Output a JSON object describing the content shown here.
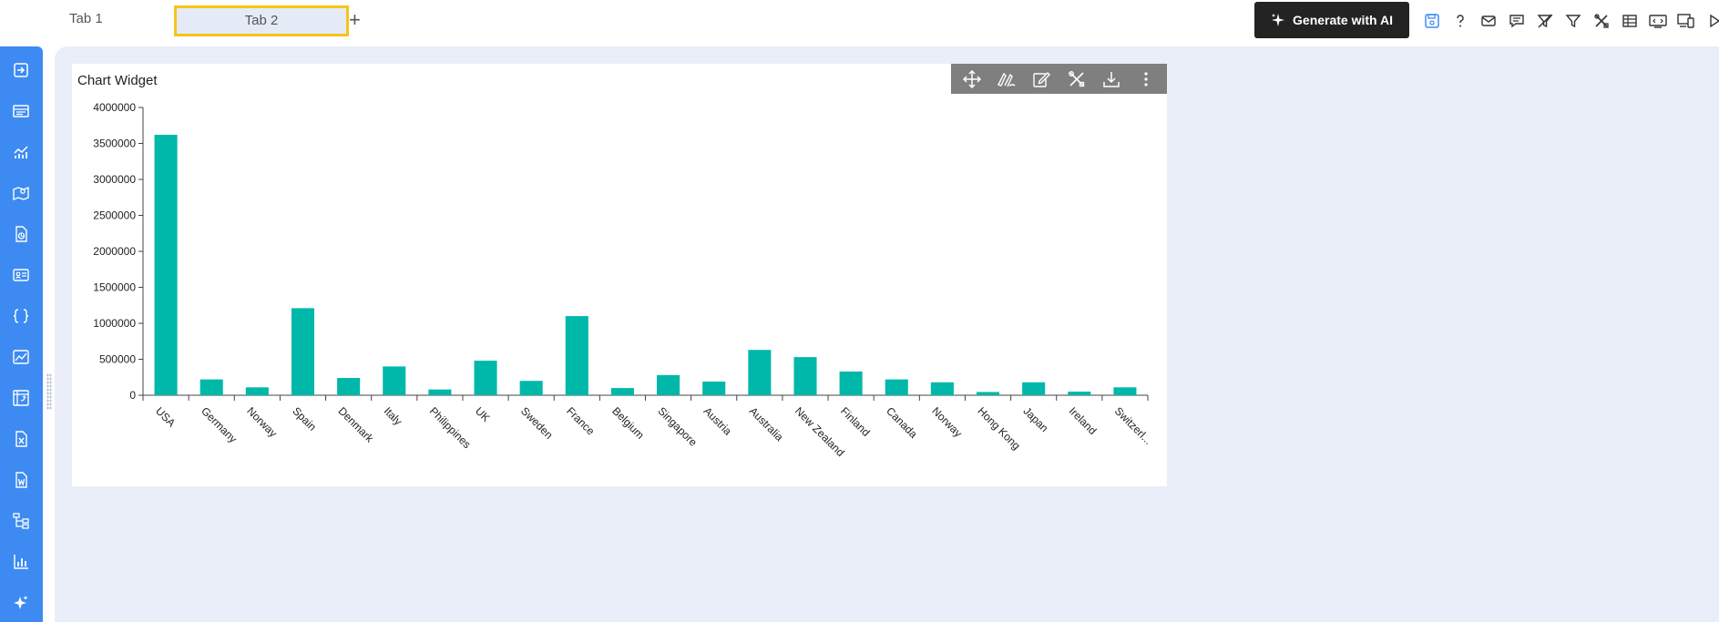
{
  "tabs": [
    {
      "label": "Tab 1"
    },
    {
      "label": "Tab 2"
    }
  ],
  "add_tab_label": "+",
  "generate_button": {
    "label": "Generate with AI"
  },
  "toolbar_icons": [
    "save-icon",
    "help-icon",
    "mail-icon",
    "comment-icon",
    "clear-filter-icon",
    "filter-icon",
    "tools-icon",
    "table-icon",
    "embed-icon",
    "devices-icon",
    "play-icon"
  ],
  "sidebar_icons": [
    "import-icon",
    "list-icon",
    "chart-icon",
    "map-icon",
    "report-icon",
    "id-card-icon",
    "code-braces-icon",
    "image-chart-icon",
    "pivot-icon",
    "excel-icon",
    "word-icon",
    "tree-icon",
    "bar-chart-icon",
    "sparkle-icon"
  ],
  "widget": {
    "title": "Chart Widget",
    "toolbar": [
      "move-icon",
      "draw-icon",
      "edit-icon",
      "settings-icon",
      "download-icon",
      "more-icon"
    ]
  },
  "colors": {
    "accent": "#3d8bf2",
    "bar": "#00b8a9",
    "highlight": "#f5c518"
  },
  "chart_data": {
    "type": "bar",
    "title": "",
    "xlabel": "",
    "ylabel": "",
    "categories": [
      "USA",
      "Germany",
      "Norway",
      "Spain",
      "Denmark",
      "Italy",
      "Philippines",
      "UK",
      "Sweden",
      "France",
      "Belgium",
      "Singapore",
      "Austria",
      "Australia",
      "New Zealand",
      "Finland",
      "Canada",
      "Norway",
      "Hong Kong",
      "Japan",
      "Ireland",
      "Switzerl..."
    ],
    "values": [
      3620000,
      220000,
      110000,
      1210000,
      240000,
      400000,
      80000,
      480000,
      200000,
      1100000,
      100000,
      280000,
      190000,
      630000,
      530000,
      330000,
      220000,
      180000,
      45000,
      180000,
      50000,
      110000
    ],
    "ylim": [
      0,
      4000000
    ],
    "yticks": [
      "0",
      "500000",
      "1000000",
      "1500000",
      "2000000",
      "2500000",
      "3000000",
      "3500000",
      "4000000"
    ],
    "grid": false,
    "legend": "none"
  }
}
